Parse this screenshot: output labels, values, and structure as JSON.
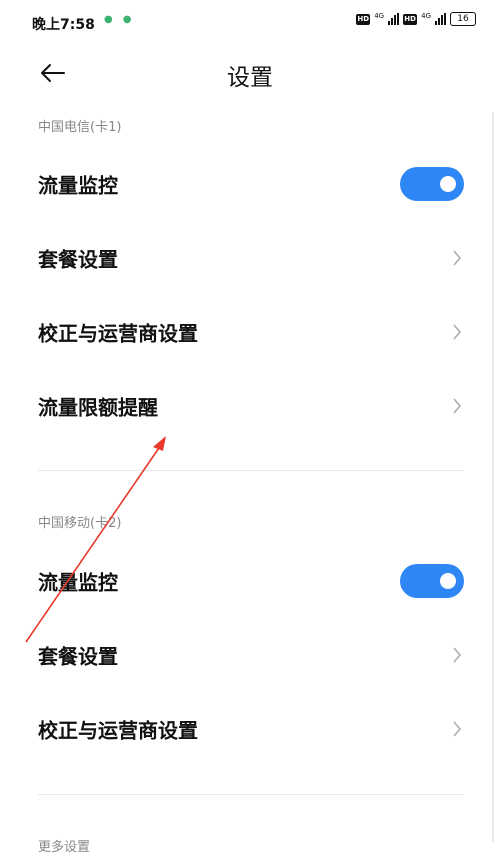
{
  "status_bar": {
    "time": "晚上7:58",
    "hd_label": "HD",
    "network": "4G",
    "battery": "16",
    "colors": {
      "dot": "#3cb371"
    }
  },
  "header": {
    "title": "设置",
    "back_icon": "back-arrow-icon"
  },
  "sections": [
    {
      "label": "中国电信(卡1)",
      "items": [
        {
          "label": "流量监控",
          "control": "toggle",
          "on": true
        },
        {
          "label": "套餐设置",
          "control": "chevron"
        },
        {
          "label": "校正与运营商设置",
          "control": "chevron"
        },
        {
          "label": "流量限额提醒",
          "control": "chevron"
        }
      ]
    },
    {
      "label": "中国移动(卡2)",
      "items": [
        {
          "label": "流量监控",
          "control": "toggle",
          "on": true
        },
        {
          "label": "套餐设置",
          "control": "chevron"
        },
        {
          "label": "校正与运营商设置",
          "control": "chevron"
        }
      ]
    },
    {
      "label": "更多设置",
      "items": []
    }
  ],
  "colors": {
    "accent": "#2f87f5",
    "annotation": "#e8392b",
    "section_label": "#888888"
  }
}
